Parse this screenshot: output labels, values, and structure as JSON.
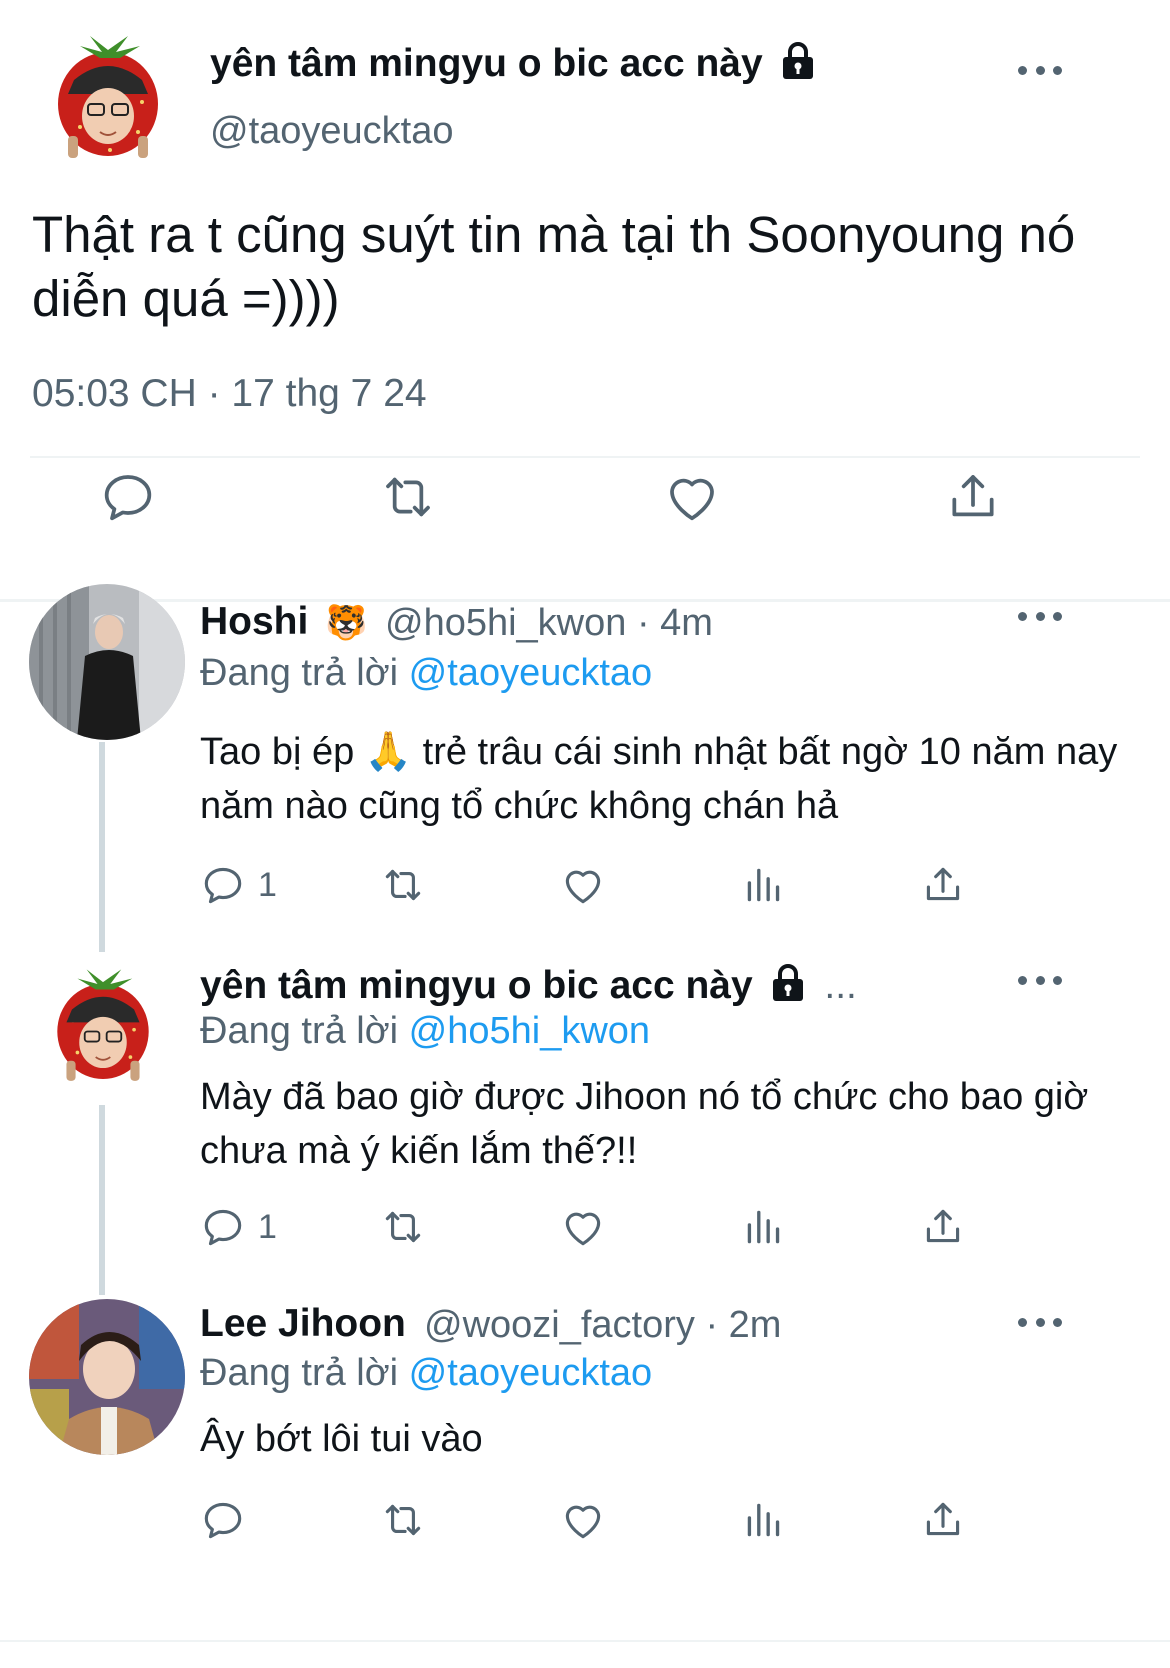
{
  "main_tweet": {
    "display_name": "yên tâm mingyu o bic acc này",
    "lock_icon": "lock-icon",
    "handle": "@taoyeucktao",
    "text": "Thật ra t cũng suýt tin mà tại th Soonyoung nó diễn quá =))))",
    "timestamp": "05:03 CH · 17 thg 7 24",
    "more_icon": "more-dots-icon"
  },
  "replies": [
    {
      "display_name": "Hoshi",
      "emoji": "🐯",
      "handle_time": "@ho5hi_kwon · 4m",
      "reply_prefix": "Đang trả lời",
      "reply_to": "@taoyeucktao",
      "text": "Tao bị ép 🙏  trẻ trâu cái sinh nhật bất ngờ 10 năm nay năm nào cũng tổ chức không chán hả",
      "reply_count": "1"
    },
    {
      "display_name": "yên tâm mingyu o bic acc này",
      "ellipsis": "...",
      "reply_prefix": "Đang trả lời",
      "reply_to": "@ho5hi_kwon",
      "text": "Mày đã bao giờ được Jihoon nó tổ chức cho bao giờ chưa mà ý kiến lắm thế?!!",
      "reply_count": "1"
    },
    {
      "display_name": "Lee Jihoon",
      "handle_time": "@woozi_factory · 2m",
      "reply_prefix": "Đang trả lời",
      "reply_to": "@taoyeucktao",
      "text": "Ây bớt lôi tui vào",
      "reply_count": ""
    }
  ],
  "colors": {
    "text": "#0f1419",
    "secondary": "#536471",
    "link": "#1d9bf0",
    "divider": "#eff3f4",
    "thread_line": "#cfd9de"
  }
}
